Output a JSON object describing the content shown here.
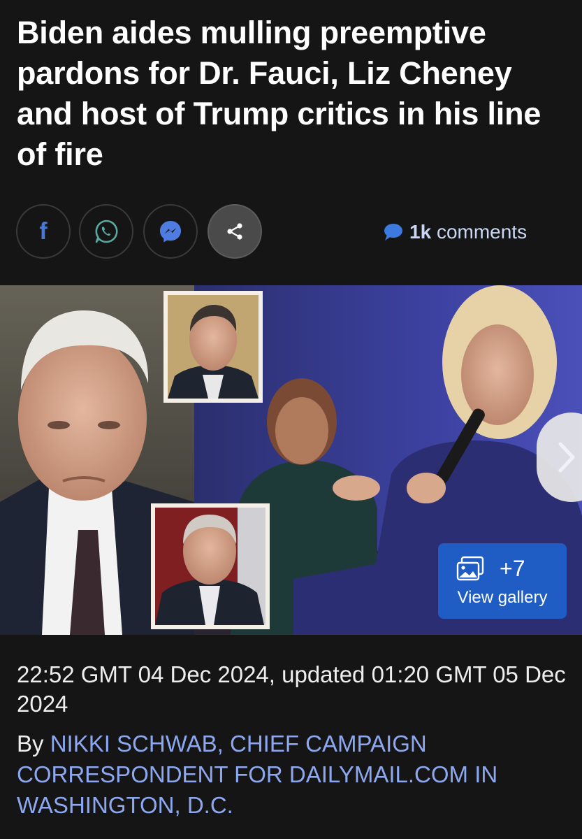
{
  "article": {
    "headline": "Biden aides mulling preemptive pardons for Dr. Fauci, Liz Cheney and host of Trump critics in his line of fire",
    "timestamp": "22:52 GMT 04 Dec 2024, updated 01:20 GMT 05 Dec 2024",
    "byline_prefix": "By",
    "author": "NIKKI SCHWAB, CHIEF CAMPAIGN CORRESPONDENT FOR DAILYMAIL.COM IN WASHINGTON, D.C."
  },
  "share": {
    "facebook_icon": "facebook-icon",
    "facebook_glyph": "f",
    "whatsapp_icon": "whatsapp-icon",
    "messenger_icon": "messenger-icon",
    "share_icon": "share-icon"
  },
  "comments": {
    "icon": "speech-bubble-icon",
    "count": "1k",
    "label": "comments"
  },
  "gallery": {
    "icon": "photo-stack-icon",
    "count": "+7",
    "label": "View gallery"
  },
  "carousel": {
    "next_icon": "chevron-right-icon"
  },
  "colors": {
    "background": "#151515",
    "link_blue": "#8da8f0",
    "gallery_button": "#1f5cc4",
    "facebook_blue": "#4a78d6",
    "hero_backdrop": "#3b3f8f"
  }
}
